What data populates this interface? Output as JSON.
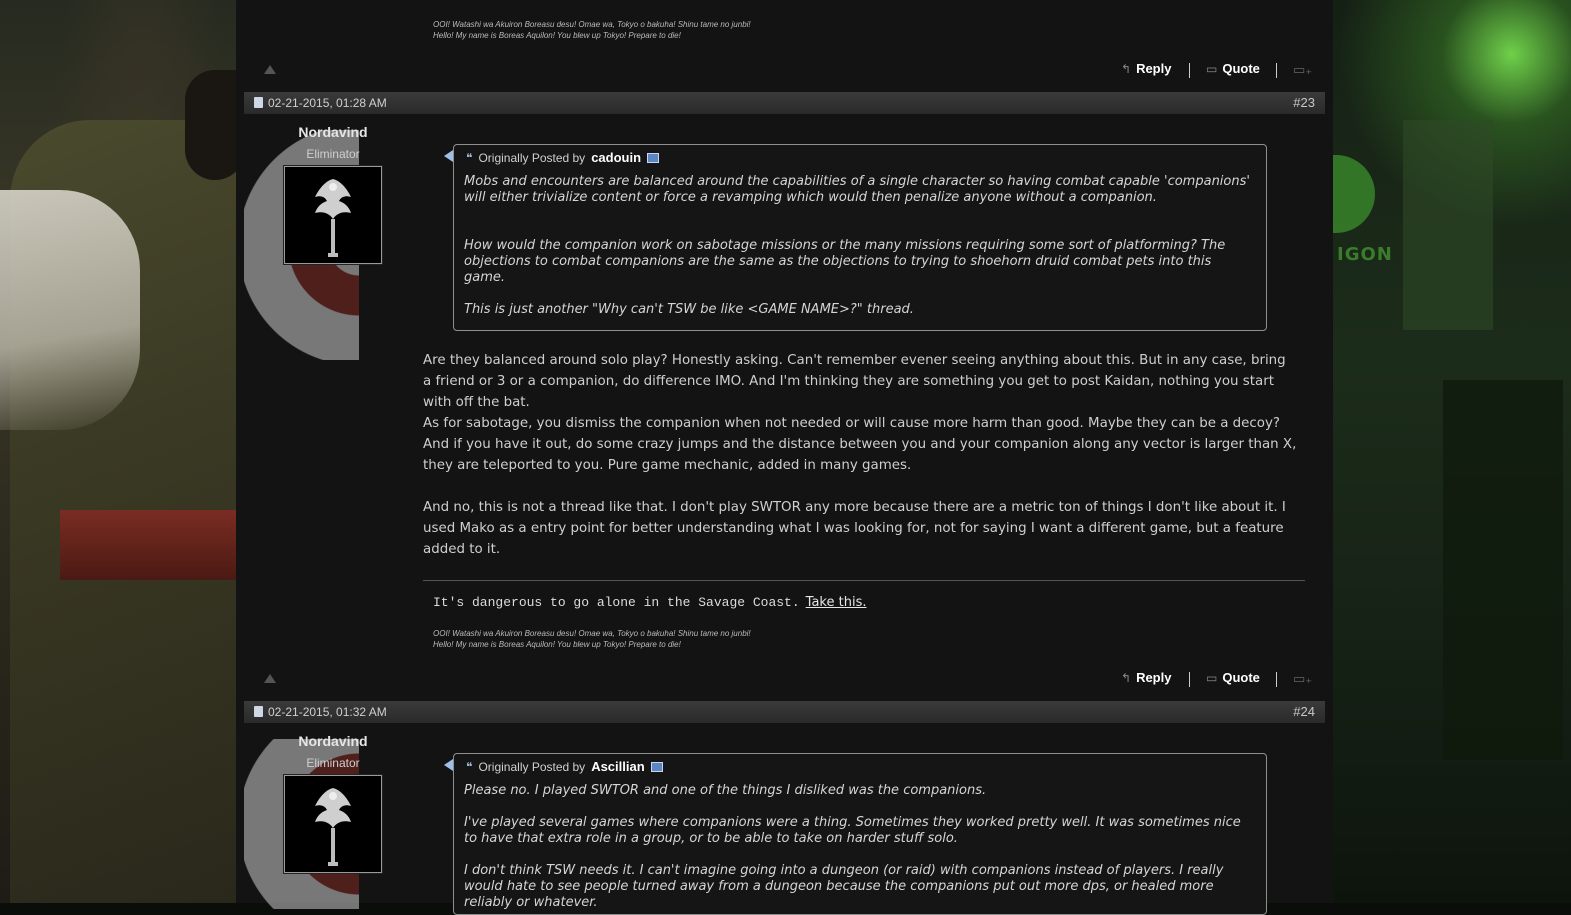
{
  "signature": {
    "line": "It's dangerous to go alone in the Savage Coast.",
    "link": "Take this.",
    "jp": "OOI! Watashi wa Akuiron Boreasu desu! Omae wa, Tokyo o bakuha! Shinu tame no junbi!",
    "en": "Hello! My name is Boreas Aquilon! You blew up Tokyo! Prepare to die!"
  },
  "actions": {
    "reply": "Reply",
    "quote": "Quote"
  },
  "posts": [
    {
      "date": "02-21-2015, 01:28 AM",
      "number": "#23",
      "user": {
        "name": "Nordavind",
        "title": "Eliminator"
      },
      "quote": {
        "prefix": "Originally Posted by",
        "author": "cadouin",
        "p1": "Mobs and encounters are balanced around the capabilities of a single character so having combat capable 'companions' will either trivialize content or force a revamping which would then penalize anyone without a companion.",
        "p2": "How would the companion work on sabotage missions or the many missions requiring some sort of platforming? The objections to combat companions are the same as the objections to trying to shoehorn druid combat pets into this game.",
        "p3": "This is just another \"Why can't TSW be like <GAME NAME>?\" thread."
      },
      "body": {
        "p1": "Are they balanced around solo play? Honestly asking. Can't remember evener seeing anything about this. But in any case, bring a friend or 3 or a companion, do difference IMO. And I'm thinking they are something you get to post Kaidan, nothing you start with off the bat.",
        "p2": "As for sabotage, you dismiss the companion when not needed or will cause more harm than good. Maybe they can be a decoy? And if you have it out, do some crazy jumps and the distance between you and your companion along any vector is larger than X, they are teleported to you. Pure game mechanic, added in many games.",
        "p3": "And no, this is not a thread like that. I don't play SWTOR any more because there are a metric ton of things I don't like about it. I used Mako as a entry point for better understanding what I was looking for, not for saying I want a different game, but a feature added to it."
      }
    },
    {
      "date": "02-21-2015, 01:32 AM",
      "number": "#24",
      "user": {
        "name": "Nordavind",
        "title": "Eliminator"
      },
      "quote": {
        "prefix": "Originally Posted by",
        "author": "Ascillian",
        "p1": "Please no. I played SWTOR and one of the things I disliked was the companions.",
        "p2": "I've played several games where companions were a thing. Sometimes they worked pretty well. It was sometimes nice to have that extra role in a group, or to be able to take on harder stuff solo.",
        "p3": "I don't think TSW needs it. I can't imagine going into a dungeon (or raid) with companions instead of players. I really would hate to see people turned away from a dungeon because the companions put out more dps, or healed more reliably or whatever."
      }
    }
  ],
  "colors": {
    "bg_column": "#131313",
    "header": "#2f2f2f",
    "quote_border": "#8f8f8f",
    "accent_green": "#3a8a2c"
  },
  "icons": [
    "back-to-top-icon",
    "reply-icon",
    "quote-icon",
    "multi-quote-icon",
    "post-doc-icon",
    "quote-marks-icon",
    "view-post-icon"
  ]
}
